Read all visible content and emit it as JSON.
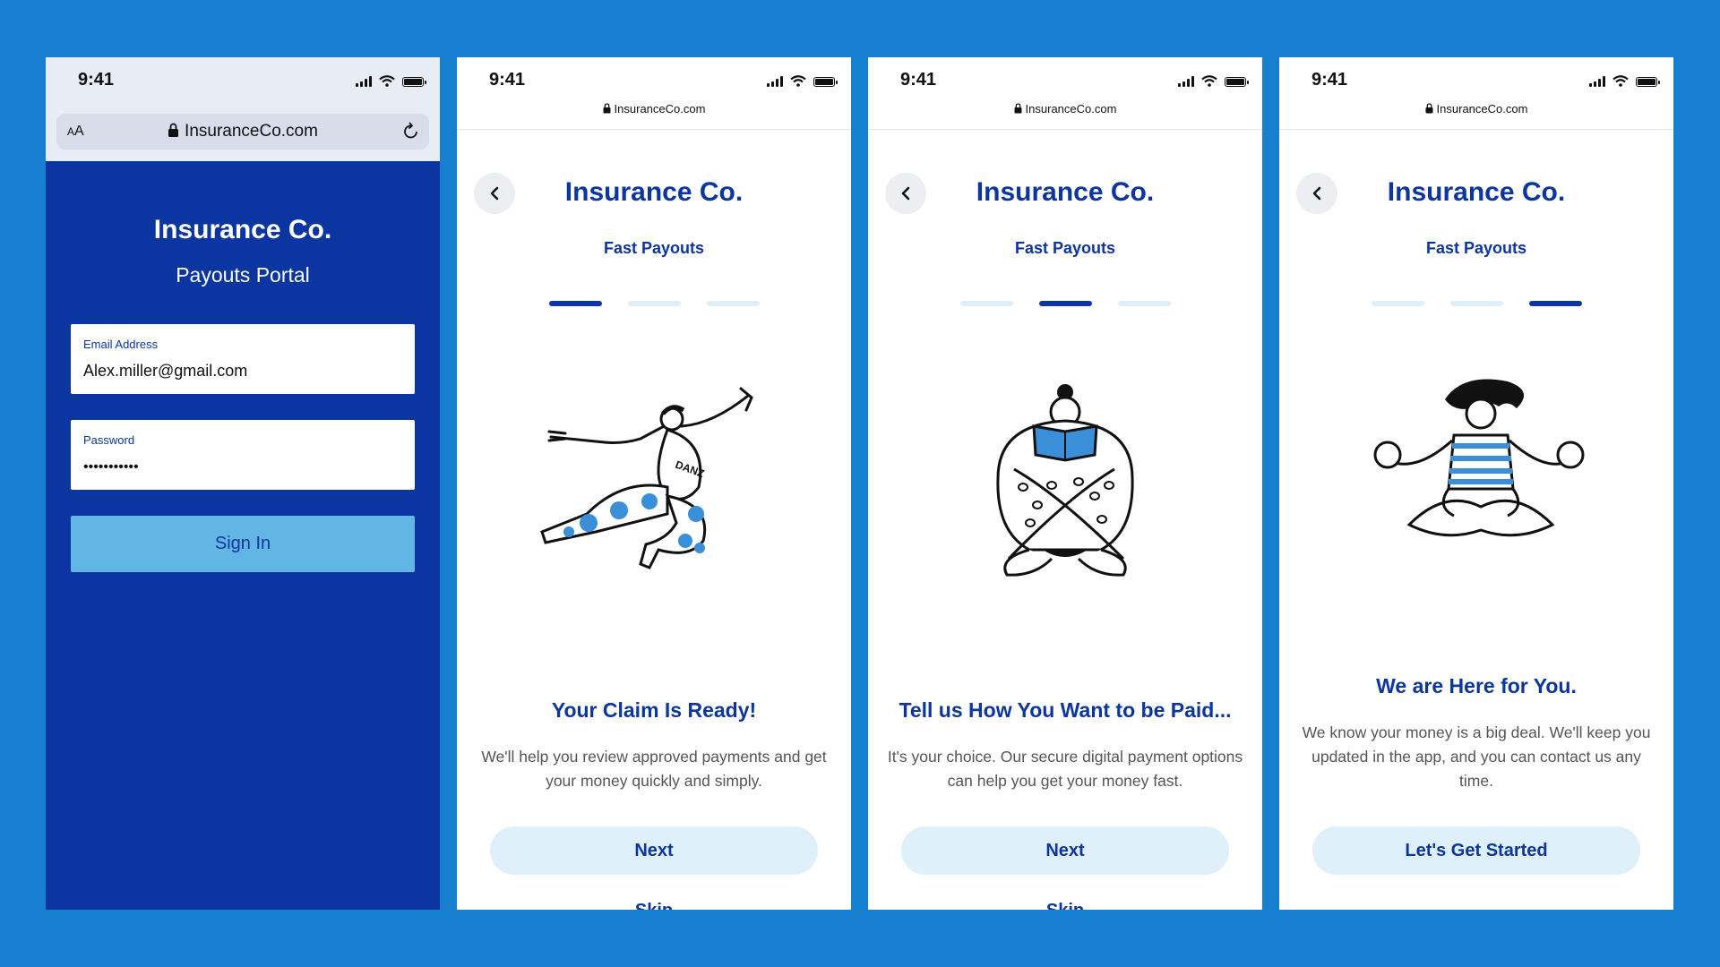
{
  "colors": {
    "background": "#167fd0",
    "brand_navy": "#0b35a0",
    "light_blue": "#62b6e3",
    "pill_bg": "#dff0fb"
  },
  "status_bar": {
    "time": "9:41"
  },
  "login": {
    "aa": "AA",
    "url": "InsuranceCo.com",
    "title": "Insurance Co.",
    "subtitle": "Payouts Portal",
    "email_label": "Email Address",
    "email_value": "Alex.miller@gmail.com",
    "password_label": "Password",
    "password_value": "•••••••••••",
    "sign_in_label": "Sign In"
  },
  "onboarding": {
    "url": "InsuranceCo.com",
    "title": "Insurance Co.",
    "subtitle": "Fast Payouts",
    "screens": [
      {
        "illustration": "dancing-person",
        "active_step": 1,
        "headline": "Your Claim Is Ready!",
        "body": "We'll help you review approved payments and get your money quickly and simply.",
        "primary_label": "Next",
        "skip_label": "Skip"
      },
      {
        "illustration": "reading-person",
        "active_step": 2,
        "headline": "Tell us How You Want to be Paid...",
        "body": "It's your choice. Our secure digital payment options can help you get your money fast.",
        "primary_label": "Next",
        "skip_label": "Skip"
      },
      {
        "illustration": "meditating-person",
        "active_step": 3,
        "headline": "We are Here for You.",
        "body": "We know your money is a big deal. We'll keep you updated in the app, and you can contact us any time.",
        "primary_label": "Let's Get Started"
      }
    ]
  }
}
